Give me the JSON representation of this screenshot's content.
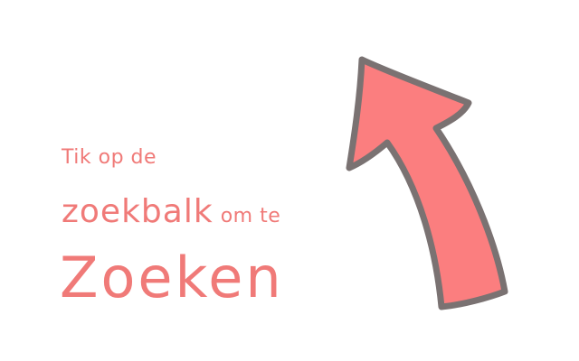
{
  "hint": {
    "line1": "Tik op de",
    "line2_big": "zoekbalk",
    "line2_small": "om te",
    "line3": "Zoeken"
  },
  "colors": {
    "text": "#f07a78",
    "arrow_fill": "#fb7e7f",
    "arrow_outline": "#7a7272",
    "background": "#ffffff"
  },
  "icons": {
    "arrow": "arrow-up-curved-icon"
  }
}
